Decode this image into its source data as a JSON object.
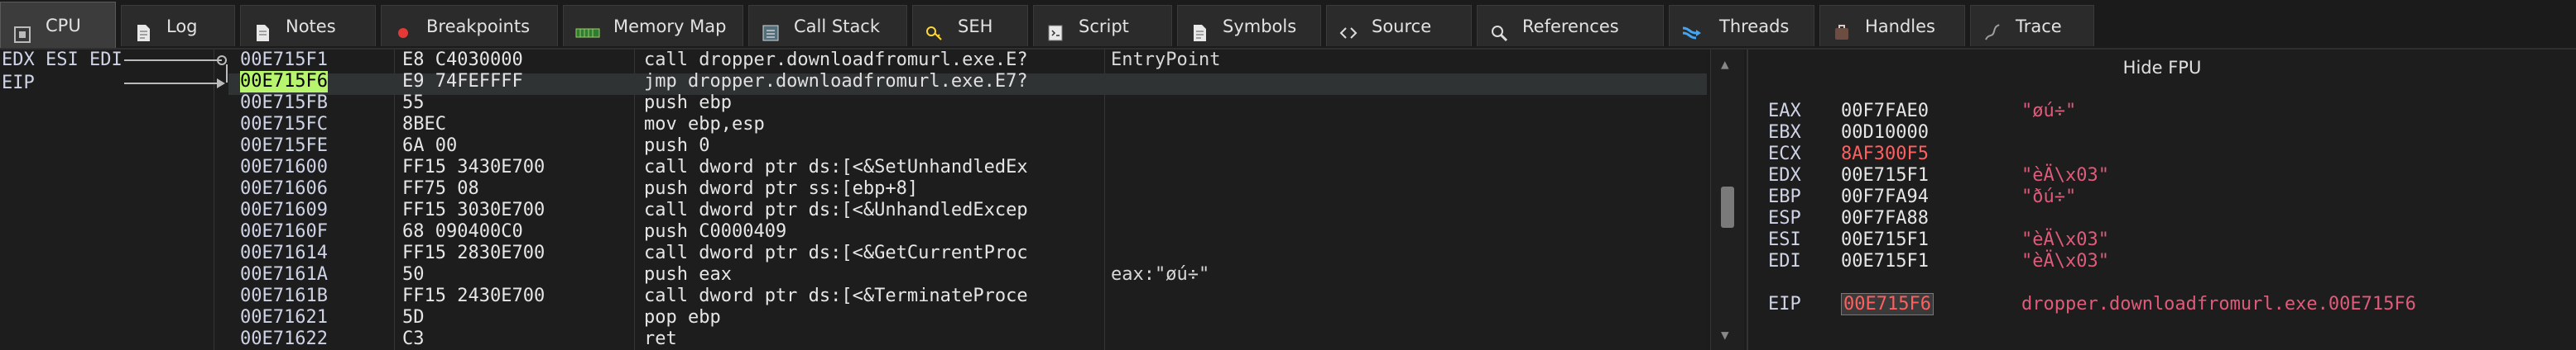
{
  "tabs": [
    {
      "label": "CPU",
      "icon": "cpu-icon",
      "active": true
    },
    {
      "label": "Log",
      "icon": "log-icon"
    },
    {
      "label": "Notes",
      "icon": "notes-icon"
    },
    {
      "label": "Breakpoints",
      "icon": "breakpoint-dot-icon"
    },
    {
      "label": "Memory Map",
      "icon": "memory-map-icon"
    },
    {
      "label": "Call Stack",
      "icon": "call-stack-icon"
    },
    {
      "label": "SEH",
      "icon": "seh-icon"
    },
    {
      "label": "Script",
      "icon": "script-icon"
    },
    {
      "label": "Symbols",
      "icon": "symbols-icon"
    },
    {
      "label": "Source",
      "icon": "source-icon"
    },
    {
      "label": "References",
      "icon": "references-icon"
    },
    {
      "label": "Threads",
      "icon": "threads-icon"
    },
    {
      "label": "Handles",
      "icon": "handles-icon"
    },
    {
      "label": "Trace",
      "icon": "trace-icon"
    }
  ],
  "regs_left": {
    "line1": "EDX ESI EDI",
    "line2": "EIP"
  },
  "disasm": {
    "rows": [
      {
        "addr": "00E715F1",
        "bytes": "E8 C4030000",
        "ins": "call dropper.downloadfromurl.exe.E?",
        "cmt": "EntryPoint"
      },
      {
        "addr": "00E715F6",
        "bytes": "E9 74FEFFFF",
        "ins": "jmp dropper.downloadfromurl.exe.E7?",
        "cmt": ""
      },
      {
        "addr": "00E715FB",
        "bytes": "55",
        "ins": "push ebp",
        "cmt": ""
      },
      {
        "addr": "00E715FC",
        "bytes": "8BEC",
        "ins": "mov ebp,esp",
        "cmt": ""
      },
      {
        "addr": "00E715FE",
        "bytes": "6A 00",
        "ins": "push 0",
        "cmt": ""
      },
      {
        "addr": "00E71600",
        "bytes": "FF15 3430E700",
        "ins": "call dword ptr ds:[<&SetUnhandledEx",
        "cmt": ""
      },
      {
        "addr": "00E71606",
        "bytes": "FF75 08",
        "ins": "push dword ptr ss:[ebp+8]",
        "cmt": ""
      },
      {
        "addr": "00E71609",
        "bytes": "FF15 3030E700",
        "ins": "call dword ptr ds:[<&UnhandledExcep",
        "cmt": ""
      },
      {
        "addr": "00E7160F",
        "bytes": "68 090400C0",
        "ins": "push C0000409",
        "cmt": ""
      },
      {
        "addr": "00E71614",
        "bytes": "FF15 2830E700",
        "ins": "call dword ptr ds:[<&GetCurrentProc",
        "cmt": ""
      },
      {
        "addr": "00E7161A",
        "bytes": "50",
        "ins": "push eax",
        "cmt": "eax:\"øú÷\""
      },
      {
        "addr": "00E7161B",
        "bytes": "FF15 2430E700",
        "ins": "call dword ptr ds:[<&TerminateProce",
        "cmt": ""
      },
      {
        "addr": "00E71621",
        "bytes": "5D",
        "ins": "pop ebp",
        "cmt": ""
      },
      {
        "addr": "00E71622",
        "bytes": "C3",
        "ins": "ret",
        "cmt": ""
      }
    ]
  },
  "fpu": {
    "title": "Hide FPU"
  },
  "registers": [
    {
      "name": "EAX",
      "value": "00F7FAE0",
      "str": "\"øú÷\"",
      "changed": false
    },
    {
      "name": "EBX",
      "value": "00D10000",
      "str": "",
      "changed": false
    },
    {
      "name": "ECX",
      "value": "8AF300F5",
      "str": "",
      "changed": true
    },
    {
      "name": "EDX",
      "value": "00E715F1",
      "str": "\"èÄ\\x03\"",
      "changed": false
    },
    {
      "name": "EBP",
      "value": "00F7FA94",
      "str": "\"ðú÷\"",
      "changed": false
    },
    {
      "name": "ESP",
      "value": "00F7FA88",
      "str": "",
      "changed": false
    },
    {
      "name": "ESI",
      "value": "00E715F1",
      "str": "\"èÄ\\x03\"",
      "changed": false
    },
    {
      "name": "EDI",
      "value": "00E715F1",
      "str": "\"èÄ\\x03\"",
      "changed": false
    }
  ],
  "eip": {
    "name": "EIP",
    "value": "00E715F6",
    "str": "dropper.downloadfromurl.exe.00E715F6"
  }
}
